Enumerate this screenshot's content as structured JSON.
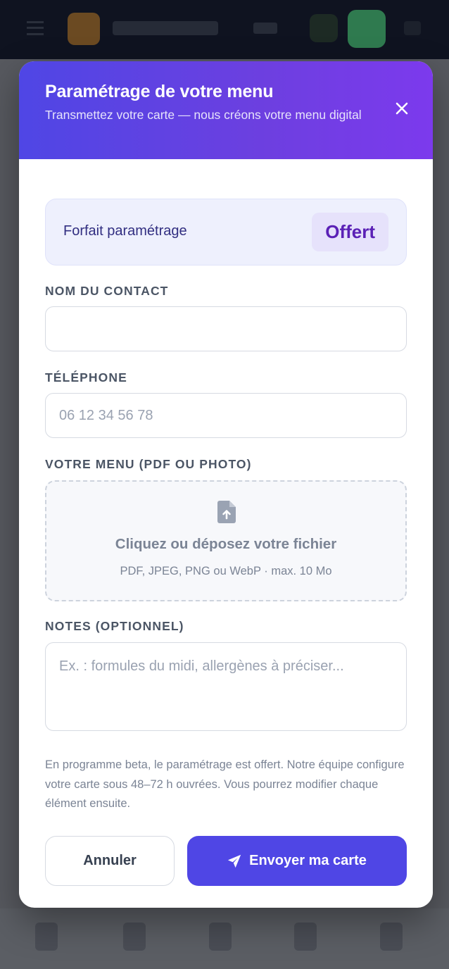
{
  "modal": {
    "title": "Paramétrage de votre menu",
    "subtitle": "Transmettez votre carte — nous créons votre menu digital",
    "close_icon": "close-icon"
  },
  "plan": {
    "label": "Forfait paramétrage",
    "badge": "Offert"
  },
  "fields": {
    "contact_name": {
      "label": "NOM DU CONTACT",
      "value": "",
      "placeholder": ""
    },
    "phone": {
      "label": "TÉLÉPHONE",
      "value": "",
      "placeholder": "06 12 34 56 78"
    },
    "menu_upload": {
      "label": "VOTRE MENU (PDF OU PHOTO)",
      "title": "Cliquez ou déposez votre fichier",
      "hint": "PDF, JPEG, PNG ou WebP · max. 10 Mo",
      "icon": "file-upload-icon"
    },
    "notes": {
      "label": "NOTES (OPTIONNEL)",
      "value": "",
      "placeholder": "Ex. : formules du midi, allergènes à préciser..."
    }
  },
  "footnote": "En programme beta, le paramétrage est offert. Notre équipe configure votre carte sous 48–72 h ouvrées. Vous pourrez modifier chaque élément ensuite.",
  "actions": {
    "cancel_label": "Annuler",
    "submit_label": "Envoyer ma carte",
    "submit_icon": "send-icon"
  },
  "colors": {
    "accent": "#4f46e5",
    "header_gradient_end": "#7c3aed",
    "plan_badge_text": "#5b21b6",
    "overlay": "#57595f"
  }
}
